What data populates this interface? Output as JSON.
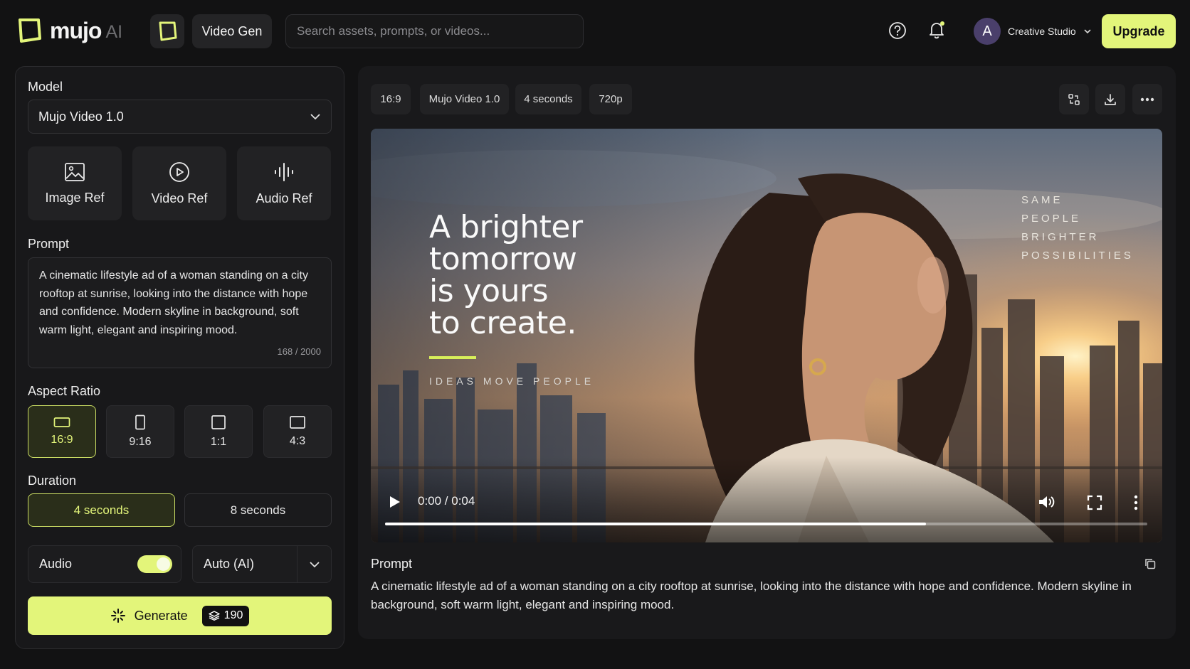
{
  "header": {
    "brand": "mujo",
    "brand_suffix": "AI",
    "app_tab": "Video Gen",
    "search_placeholder": "Search assets, prompts, or videos...",
    "avatar_initial": "A",
    "workspace": "Creative Studio",
    "upgrade_label": "Upgrade"
  },
  "left": {
    "model_label": "Model",
    "model_value": "Mujo Video 1.0",
    "refs": [
      {
        "label": "Image Ref",
        "icon": "image-icon"
      },
      {
        "label": "Video Ref",
        "icon": "play-circle-icon"
      },
      {
        "label": "Audio Ref",
        "icon": "waveform-icon"
      }
    ],
    "prompt_label": "Prompt",
    "prompt_text": "A cinematic lifestyle ad of a woman standing on a city rooftop at sunrise, looking into the distance with hope and confidence. Modern skyline in background, soft warm light, elegant and inspiring mood.",
    "char_count": "168 / 2000",
    "aspect_label": "Aspect Ratio",
    "aspects": [
      "16:9",
      "9:16",
      "1:1",
      "4:3"
    ],
    "aspect_selected": "16:9",
    "duration_label": "Duration",
    "durations": [
      "4 seconds",
      "8 seconds"
    ],
    "duration_selected": "4 seconds",
    "audio_label": "Audio",
    "audio_on": true,
    "audio_mode": "Auto (AI)",
    "generate_label": "Generate",
    "credits": "190"
  },
  "right": {
    "chips": [
      "16:9",
      "Mujo Video 1.0",
      "4 seconds",
      "720p"
    ],
    "video": {
      "headline": "A brighter\ntomorrow\nis yours\nto create.",
      "tagline": "IDEAS MOVE PEOPLE",
      "side_words": "SAME\nPEOPLE\nBRIGHTER\nPOSSIBILITIES",
      "time": "0:00 / 0:04",
      "progress": 0.71
    },
    "prompt_label": "Prompt",
    "prompt_text": "A cinematic lifestyle ad of a woman standing on a city rooftop at sunrise, looking into the distance with hope and confidence. Modern skyline in background, soft warm light, elegant and inspiring mood."
  },
  "colors": {
    "accent": "#e3f57a",
    "background": "#121213",
    "panel": "#18181a"
  }
}
